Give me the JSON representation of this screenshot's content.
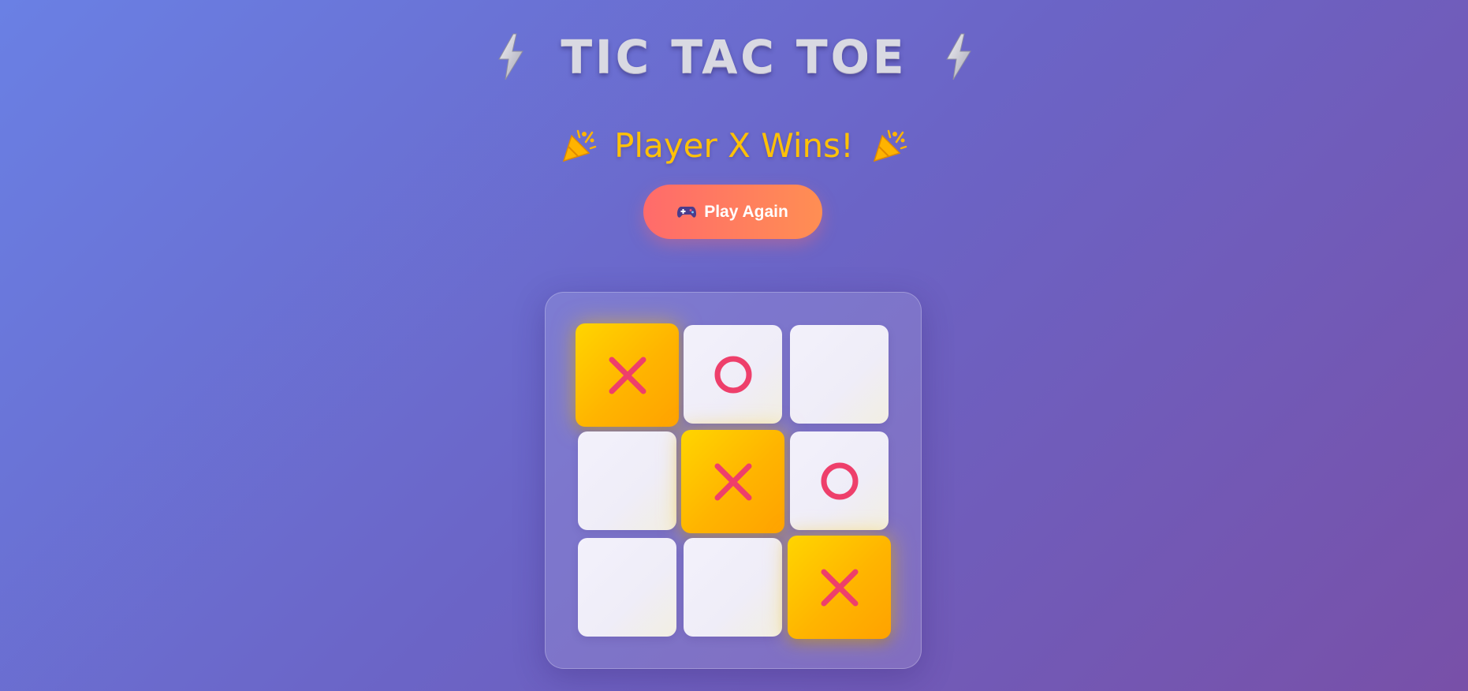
{
  "header": {
    "title": "TIC TAC TOE",
    "left_icon": "lightning-bolt-icon",
    "right_icon": "lightning-bolt-icon"
  },
  "status": {
    "text": "Player X Wins!",
    "left_icon": "party-popper-icon",
    "right_icon": "party-popper-icon"
  },
  "play_again": {
    "label": "Play Again",
    "icon": "gamepad-icon"
  },
  "board": {
    "cells": [
      "X",
      "O",
      "",
      "",
      "X",
      "O",
      "",
      "",
      "X"
    ],
    "winning_cells": [
      0,
      4,
      8
    ],
    "winner": "X"
  },
  "colors": {
    "background_start": "#6a80e4",
    "background_end": "#7850a8",
    "status_text": "#ffc107",
    "button_start": "#ff6b6b",
    "button_end": "#ff8e53",
    "win_cell": "#ffc400",
    "mark": "#ee3f6b"
  }
}
